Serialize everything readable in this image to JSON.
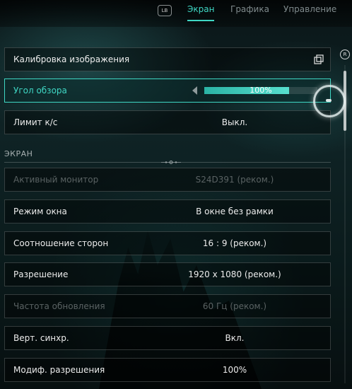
{
  "topbar": {
    "lb_label": "LB",
    "tabs": [
      {
        "label": "Экран",
        "active": true
      },
      {
        "label": "Графика",
        "active": false
      },
      {
        "label": "Управление",
        "active": false
      }
    ]
  },
  "scrollbar": {
    "button_label": "R"
  },
  "rows_top": [
    {
      "label": "Калибровка изображения",
      "icon": "copy-icon"
    },
    {
      "label": "Угол обзора",
      "value": "100%",
      "slider_fraction": 0.75
    },
    {
      "label": "Лимит к/с",
      "value": "Выкл."
    }
  ],
  "section": {
    "title": "ЭКРАН"
  },
  "rows": [
    {
      "label": "Активный монитор",
      "value": "S24D391 (реком.)",
      "disabled": true
    },
    {
      "label": "Режим окна",
      "value": "В окне без рамки"
    },
    {
      "label": "Соотношение сторон",
      "value": "16 : 9 (реком.)"
    },
    {
      "label": "Разрешение",
      "value": "1920 x 1080 (реком.)"
    },
    {
      "label": "Частота обновления",
      "value": "60 Гц (реком.)",
      "disabled": true
    },
    {
      "label": "Верт. синхр.",
      "value": "Вкл."
    },
    {
      "label": "Модиф. разрешения",
      "value": "100%"
    }
  ],
  "colors": {
    "accent": "#3fd7c4",
    "disabled_text": "#5a6263"
  }
}
